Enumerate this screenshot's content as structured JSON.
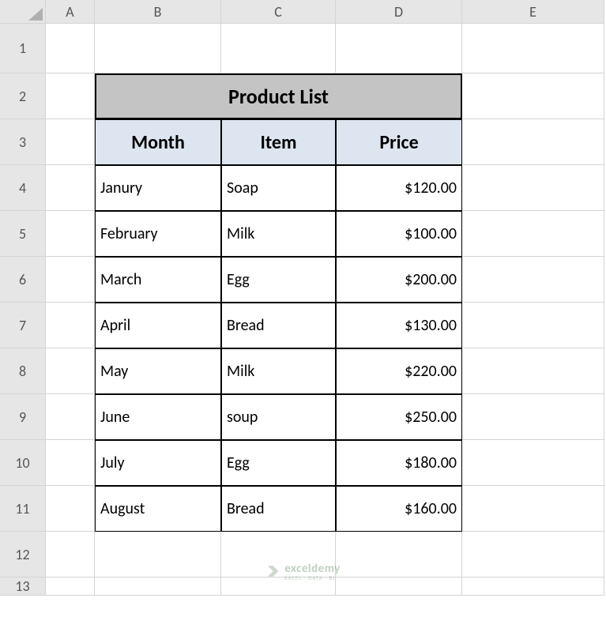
{
  "columns": [
    "A",
    "B",
    "C",
    "D",
    "E"
  ],
  "rows": [
    "1",
    "2",
    "3",
    "4",
    "5",
    "6",
    "7",
    "8",
    "9",
    "10",
    "11",
    "12",
    "13"
  ],
  "table": {
    "title": "Product List",
    "headers": [
      "Month",
      "Item",
      "Price"
    ],
    "data": [
      {
        "month": "Janury",
        "item": "Soap",
        "price": "$120.00"
      },
      {
        "month": "February",
        "item": "Milk",
        "price": "$100.00"
      },
      {
        "month": "March",
        "item": "Egg",
        "price": "$200.00"
      },
      {
        "month": "April",
        "item": "Bread",
        "price": "$130.00"
      },
      {
        "month": "May",
        "item": "Milk",
        "price": "$220.00"
      },
      {
        "month": "June",
        "item": "soup",
        "price": "$250.00"
      },
      {
        "month": "July",
        "item": "Egg",
        "price": "$180.00"
      },
      {
        "month": "August",
        "item": "Bread",
        "price": "$160.00"
      }
    ]
  },
  "watermark": {
    "text": "exceldemy",
    "sub": "EXCEL · DATA · BI"
  }
}
